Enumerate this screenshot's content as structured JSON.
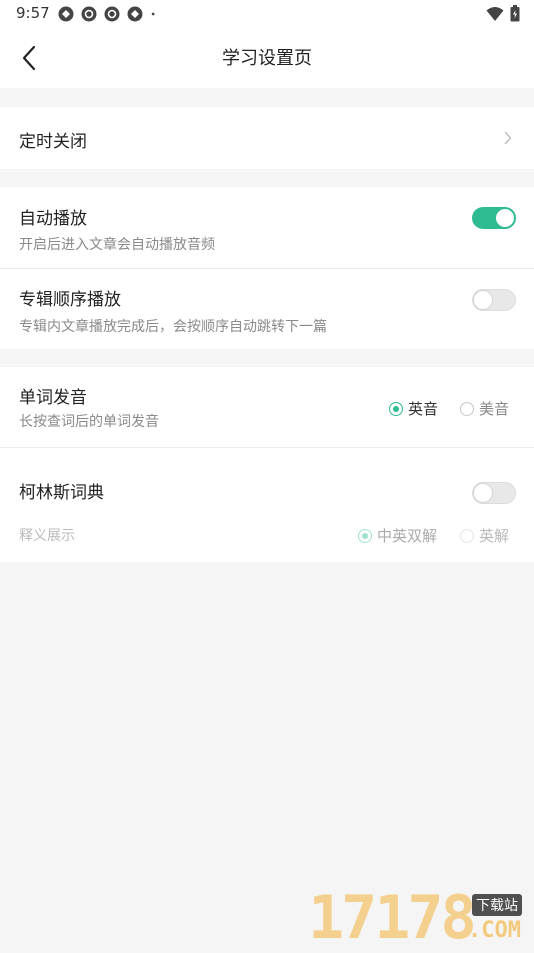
{
  "status": {
    "time": "9:57",
    "icons": [
      "app-icon-1",
      "app-icon-2",
      "app-icon-3",
      "app-icon-4",
      "dot-icon"
    ],
    "right_icons": [
      "wifi-icon",
      "battery-icon"
    ]
  },
  "header": {
    "title": "学习设置页",
    "back_icon": "chevron-left-icon"
  },
  "timer": {
    "label": "定时关闭",
    "icon": "chevron-right-icon"
  },
  "autoplay": {
    "title": "自动播放",
    "subtitle": "开启后进入文章会自动播放音频",
    "enabled": true
  },
  "album_order": {
    "title": "专辑顺序播放",
    "subtitle": "专辑内文章播放完成后，会按顺序自动跳转下一篇",
    "enabled": false
  },
  "pronunciation": {
    "title": "单词发音",
    "subtitle": "长按查词后的单词发音",
    "options": [
      "英音",
      "美音"
    ],
    "selected": "英音"
  },
  "collins": {
    "title": "柯林斯词典",
    "enabled": false,
    "sub_label": "释义展示",
    "options": [
      "中英双解",
      "英解"
    ],
    "selected": "中英双解"
  },
  "watermark": {
    "digits": "17178",
    "tag": "下载站",
    "domain": ".COM"
  },
  "colors": {
    "accent": "#2ebb92",
    "background": "#f5f5f5"
  }
}
